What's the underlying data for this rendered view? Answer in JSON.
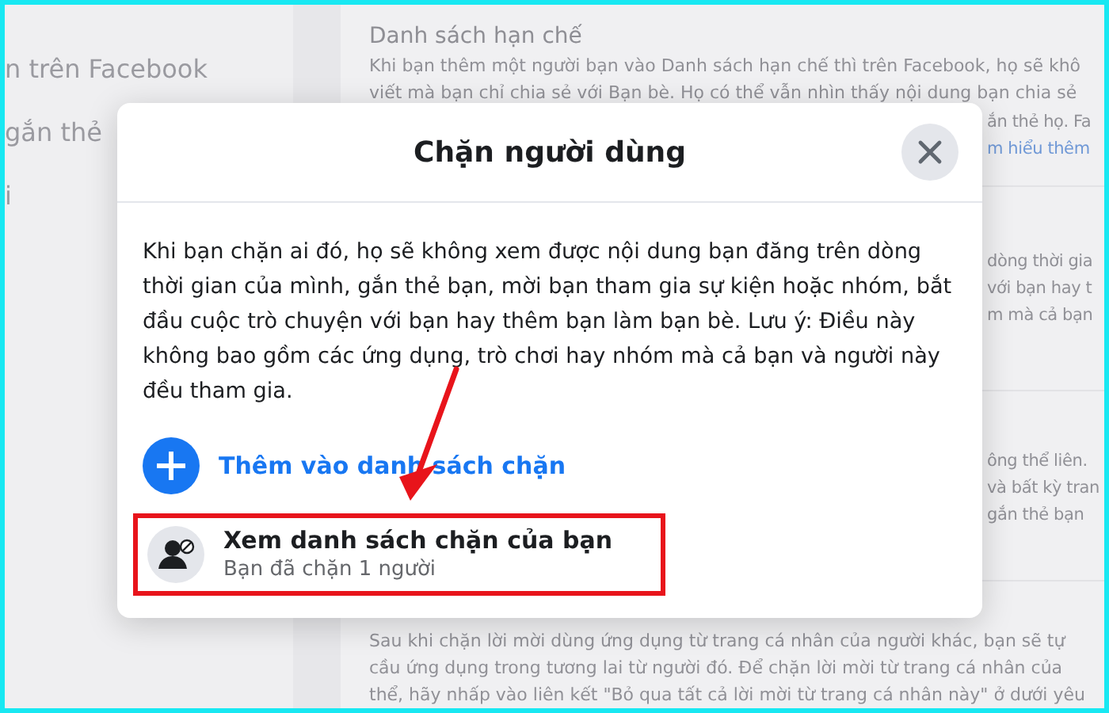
{
  "sidebar": {
    "items": [
      "n trên Facebook",
      "gắn thẻ",
      "i"
    ]
  },
  "background": {
    "section_title": "Danh sách hạn chế",
    "top_lines": [
      "Khi bạn thêm một người bạn vào Danh sách hạn chế thì trên Facebook, họ sẽ khô",
      "viết mà bạn chỉ chia sẻ với Bạn bè. Họ có thể vẫn nhìn thấy nội dung bạn chia sẻ"
    ],
    "top_tail": "ắn thẻ họ. Fa",
    "link": "m hiểu thêm",
    "middle_fragments": [
      "dòng thời gia",
      "với bạn hay t",
      "m mà cả bạn"
    ],
    "lower_fragments": [
      "ông thể liên.",
      "và bất kỳ tran",
      "gắn thẻ bạn"
    ],
    "bottom_lines": [
      "Sau khi chặn lời mời dùng ứng dụng từ trang cá nhân của người khác, bạn sẽ tự",
      "cầu ứng dụng trong tương lai từ người đó. Để chặn lời mời từ trang cá nhân của",
      "thể, hãy nhấp vào liên kết \"Bỏ qua tất cả lời mời từ trang cá nhân này\" ở dưới yêu"
    ]
  },
  "dialog": {
    "title": "Chặn người dùng",
    "body": "Khi bạn chặn ai đó, họ sẽ không xem được nội dung bạn đăng trên dòng thời gian của mình, gắn thẻ bạn, mời bạn tham gia sự kiện hoặc nhóm, bắt đầu cuộc trò chuyện với bạn hay thêm bạn làm bạn bè. Lưu ý: Điều này không bao gồm các ứng dụng, trò chơi hay nhóm mà cả bạn và người này đều tham gia.",
    "actions": [
      {
        "kind": "add",
        "label": "Thêm vào danh sách chặn"
      },
      {
        "kind": "list",
        "label": "Xem danh sách chặn của bạn",
        "subtitle": "Bạn đã chặn 1 người",
        "highlighted": true
      }
    ]
  },
  "annotation": {
    "arrow": true
  }
}
